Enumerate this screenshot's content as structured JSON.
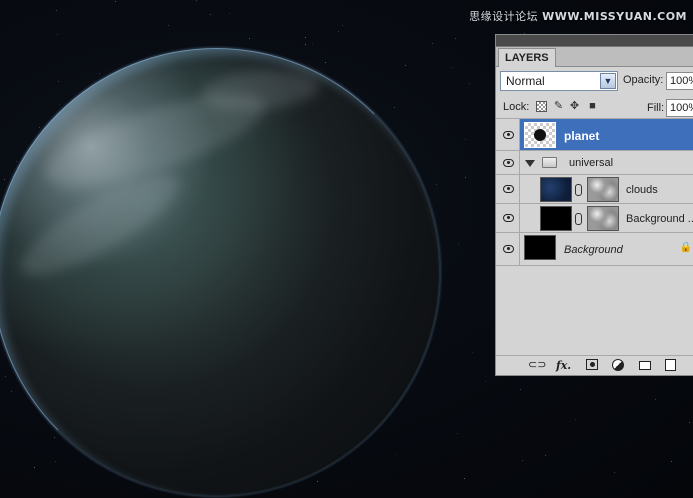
{
  "watermark": {
    "cn_text": "思缘设计论坛",
    "url_text": "WWW.MISSYUAN.COM"
  },
  "panel": {
    "tab_label": "LAYERS",
    "blend_mode": "Normal",
    "opacity_label": "Opacity:",
    "opacity_value": "100%",
    "lock_label": "Lock:",
    "fill_label": "Fill:",
    "fill_value": "100%"
  },
  "layers": [
    {
      "name": "planet",
      "selected": true,
      "visible": true
    },
    {
      "name": "universal",
      "type": "group",
      "expanded": true,
      "visible": true
    },
    {
      "name": "clouds",
      "in_group": true,
      "visible": true,
      "has_mask": true
    },
    {
      "name": "Background ...",
      "in_group": true,
      "visible": true,
      "has_mask": true
    },
    {
      "name": "Background",
      "locked": true,
      "visible": true
    }
  ],
  "colors": {
    "selection": "#3d6fba",
    "panel_bg": "#d4d4d4",
    "space_bg": "#05070b"
  }
}
